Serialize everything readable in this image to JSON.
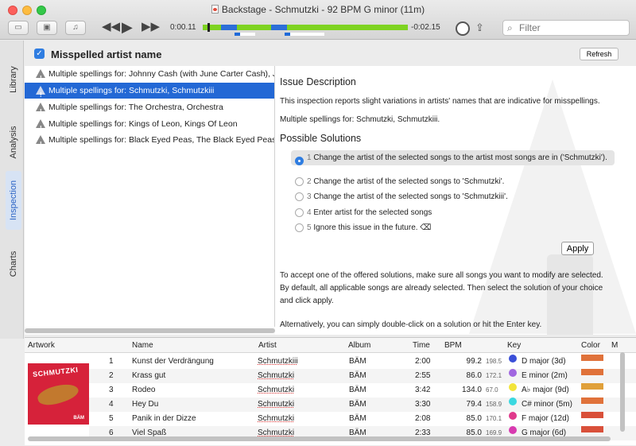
{
  "window": {
    "title": "Backstage - Schmutzki - 92 BPM G minor (11m)"
  },
  "toolbar": {
    "btn1_icon": "sidebar-icon",
    "btn2_icon": "browser-icon",
    "btn3_icon": "music-add-icon",
    "prev_glyph": "◀◀",
    "play_glyph": "▶",
    "next_glyph": "▶▶",
    "elapsed": "0:00.11",
    "remaining": "-0:02.15",
    "progress": 0.02,
    "search_placeholder": "Filter",
    "share_icon": "share-icon",
    "volume_icon": "volume-knob-icon"
  },
  "sidebar": {
    "tabs": [
      {
        "label": "Library",
        "active": false
      },
      {
        "label": "Analysis",
        "active": false
      },
      {
        "label": "Inspection",
        "active": true
      },
      {
        "label": "Charts",
        "active": false
      }
    ]
  },
  "inspection": {
    "checked": true,
    "title": "Misspelled artist name",
    "refresh_label": "Refresh",
    "items": [
      {
        "label": "Multiple spellings for: Johnny Cash (with June Carter Cash), Johnny Cash",
        "selected": false
      },
      {
        "label": "Multiple spellings for: Schmutzki, Schmutzkiii",
        "selected": true
      },
      {
        "label": "Multiple spellings for: The Orchestra, Orchestra",
        "selected": false
      },
      {
        "label": "Multiple spellings for: Kings of Leon, Kings Of Leon",
        "selected": false
      },
      {
        "label": "Multiple spellings for: Black Eyed Peas, The Black Eyed Peas",
        "selected": false
      }
    ],
    "issue_heading": "Issue Description",
    "issue_text": "This inspection reports slight variations in artists' names that are indicative for misspellings.",
    "issue_detail": "Multiple spellings for: Schmutzki, Schmutzkiii.",
    "solutions_heading": "Possible Solutions",
    "solutions": [
      {
        "num": "1",
        "text": "Change the artist of the selected songs to the artist most songs are in ('Schmutzki').",
        "selected": true
      },
      {
        "num": "2",
        "text": "Change the artist of the selected songs to 'Schmutzki'.",
        "selected": false
      },
      {
        "num": "3",
        "text": "Change the artist of the selected songs to 'Schmutzkiii'.",
        "selected": false
      },
      {
        "num": "4",
        "text": "Enter artist for the selected songs",
        "selected": false
      },
      {
        "num": "5",
        "text": "Ignore this issue in the future. ⌫",
        "selected": false
      }
    ],
    "apply_label": "Apply",
    "help_text_1": "To accept one of the offered solutions, make sure all songs you want to modify are selected.",
    "help_text_2": "By default, all applicable songs are already selected. Then select the solution of your choice",
    "help_text_3": "and click apply.",
    "help_text_4": "Alternatively, you can simply double-click on a solution or hit the Enter key."
  },
  "table": {
    "headers": {
      "artwork": "Artwork",
      "name": "Name",
      "artist": "Artist",
      "album": "Album",
      "time": "Time",
      "bpm": "BPM",
      "key": "Key",
      "color": "Color",
      "m": "M"
    },
    "artwork_logo": "SCHMUTZKI",
    "artwork_tag": "BÄM",
    "rows": [
      {
        "num": "1",
        "name": "Kunst der Verdrängung",
        "artist": "Schmutzkiii",
        "album": "BÄM",
        "time": "2:00",
        "bpm": "99.2",
        "bpm2": "198.5",
        "key": "D major (3d)",
        "key_color": "#3a4fd8",
        "color": "#e0723a"
      },
      {
        "num": "2",
        "name": "Krass gut",
        "artist": "Schmutzki",
        "album": "BÄM",
        "time": "2:55",
        "bpm": "86.0",
        "bpm2": "172.1",
        "key": "E minor (2m)",
        "key_color": "#a066e0",
        "color": "#e0723a"
      },
      {
        "num": "3",
        "name": "Rodeo",
        "artist": "Schmutzki",
        "album": "BÄM",
        "time": "3:42",
        "bpm": "134.0",
        "bpm2": "67.0",
        "key": "A♭ major (9d)",
        "key_color": "#f2e43a",
        "color": "#e0a03a"
      },
      {
        "num": "4",
        "name": "Hey Du",
        "artist": "Schmutzki",
        "album": "BÄM",
        "time": "3:30",
        "bpm": "79.4",
        "bpm2": "158.9",
        "key": "C# minor (5m)",
        "key_color": "#3ad8e0",
        "color": "#e0723a"
      },
      {
        "num": "5",
        "name": "Panik in der Dizze",
        "artist": "Schmutzki",
        "album": "BÄM",
        "time": "2:08",
        "bpm": "85.0",
        "bpm2": "170.1",
        "key": "F major (12d)",
        "key_color": "#e03a8c",
        "color": "#d9503a"
      },
      {
        "num": "6",
        "name": "Viel Spaß",
        "artist": "Schmutzki",
        "album": "BÄM",
        "time": "2:33",
        "bpm": "85.0",
        "bpm2": "169.9",
        "key": "G major (6d)",
        "key_color": "#d83ab0",
        "color": "#d9503a"
      }
    ]
  }
}
